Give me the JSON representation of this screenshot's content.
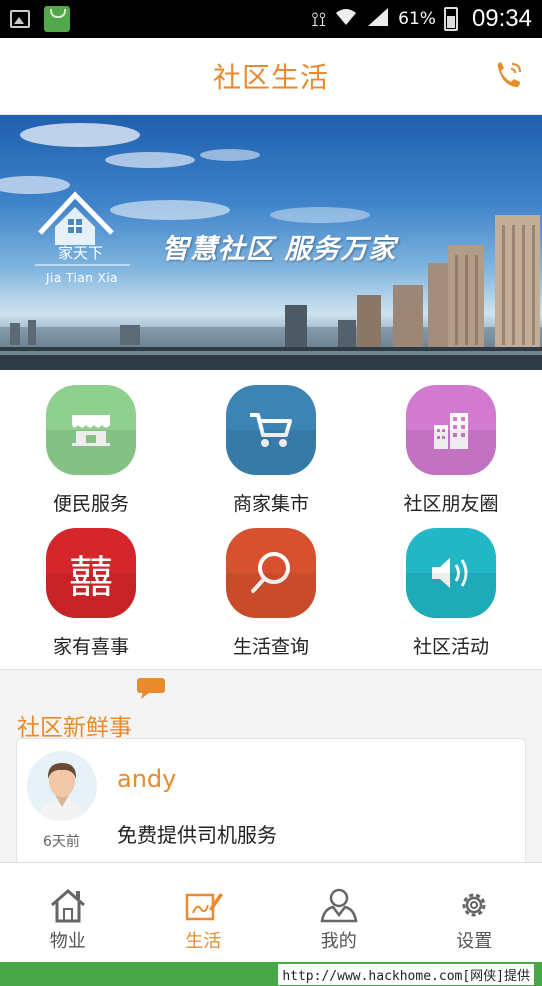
{
  "status_bar": {
    "battery": "61%",
    "time": "09:34"
  },
  "header": {
    "title": "社区生活"
  },
  "banner": {
    "slogan": "智慧社区  服务万家",
    "logo_cn": "家天下",
    "logo_en": "Jia Tian Xia"
  },
  "grid": {
    "items": [
      {
        "label": "便民服务",
        "icon": "shop-awning-icon",
        "color": "#8fd08e"
      },
      {
        "label": "商家集市",
        "icon": "shopping-cart-icon",
        "color": "#3c84b4"
      },
      {
        "label": "社区朋友圈",
        "icon": "buildings-icon",
        "color": "#d27ad0"
      },
      {
        "label": "家有喜事",
        "icon": "double-happiness-icon",
        "color": "#d5262b"
      },
      {
        "label": "生活查询",
        "icon": "magnifier-icon",
        "color": "#d8512e"
      },
      {
        "label": "社区活动",
        "icon": "speaker-icon",
        "color": "#21b7c4"
      }
    ],
    "happiness_glyph": "囍"
  },
  "news": {
    "title": "社区新鲜事",
    "card": {
      "user": "andy",
      "time": "6天前",
      "text": "免费提供司机服务"
    }
  },
  "tabbar": {
    "tabs": [
      {
        "label": "物业",
        "icon": "house-icon"
      },
      {
        "label": "生活",
        "icon": "edit-note-icon",
        "active": true
      },
      {
        "label": "我的",
        "icon": "user-icon"
      },
      {
        "label": "设置",
        "icon": "gear-icon"
      }
    ]
  },
  "footer": {
    "watermark": "http://www.hackhome.com[网侠]提供"
  },
  "colors": {
    "accent": "#e98a2c",
    "footer_green": "#48a848"
  }
}
